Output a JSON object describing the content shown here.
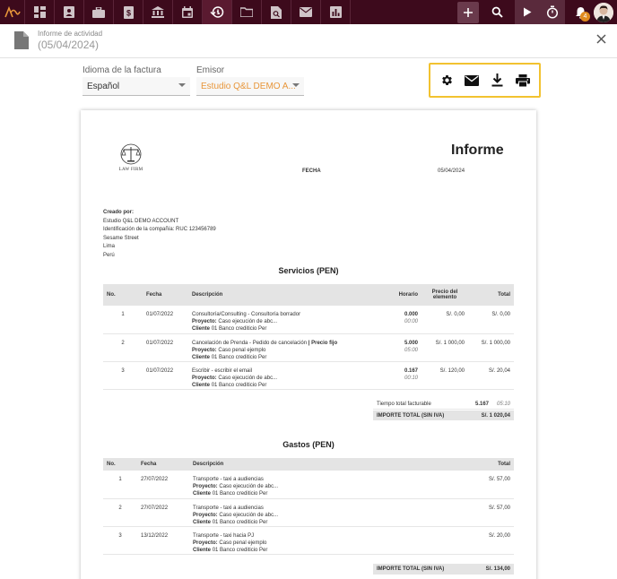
{
  "header": {
    "subtitle": "Informe de actividad",
    "title": "(05/04/2024)"
  },
  "filters": {
    "language_label": "Idioma de la factura",
    "language_value": "Español",
    "issuer_label": "Emisor",
    "issuer_value": "Estudio Q&L DEMO A..."
  },
  "notifications": {
    "count": "4"
  },
  "invoice": {
    "title": "Informe",
    "date_label": "FECHA",
    "date_value": "05/04/2024",
    "firm_name": "LAW FIRM",
    "created_by_label": "Creado por:",
    "created_lines": [
      "Estudio Q&L DEMO ACCOUNT",
      "Identificación de la compañía: RUC 123456789",
      "Sesame Street",
      "Lima",
      "Perú"
    ],
    "services": {
      "title": "Servicios (PEN)",
      "headers": {
        "no": "No.",
        "date": "Fecha",
        "desc": "Descripción",
        "hours": "Horario",
        "price": "Precio del elemento",
        "total": "Total"
      },
      "proyecto_label": "Proyecto:",
      "cliente_label": "Cliente",
      "rows": [
        {
          "no": "1",
          "date": "01/07/2022",
          "desc": "Consultoría/Consulting - Consultoría borrador",
          "desc_bold": "",
          "proyecto": "Caso ejecución de abc...",
          "cliente": "01  Banco crediticio Per",
          "hours": "0.000",
          "time": "00:00",
          "price": "S/. 0,00",
          "total": "S/. 0,00"
        },
        {
          "no": "2",
          "date": "01/07/2022",
          "desc": "Cancelación de Prenda - Pedido de cancelación",
          "desc_bold": "| Precio fijo",
          "proyecto": "Caso penal ejemplo",
          "cliente": "01  Banco crediticio Per",
          "hours": "5.000",
          "time": "05:00",
          "price": "S/. 1 000,00",
          "total": "S/. 1 000,00"
        },
        {
          "no": "3",
          "date": "01/07/2022",
          "desc": "Escribir - escribir el email",
          "desc_bold": "",
          "proyecto": "Caso ejecución de abc...",
          "cliente": "01  Banco crediticio Per",
          "hours": "0.167",
          "time": "00:10",
          "price": "S/. 120,00",
          "total": "S/. 20,04"
        }
      ],
      "billable_label": "Tiempo total facturable",
      "billable_hours": "5.167",
      "billable_time": "05:10",
      "total_label": "IMPORTE TOTAL (SIN IVA)",
      "total_value": "S/. 1 020,04"
    },
    "expenses": {
      "title": "Gastos (PEN)",
      "headers": {
        "no": "No.",
        "date": "Fecha",
        "desc": "Descripción",
        "total": "Total"
      },
      "proyecto_label": "Proyecto:",
      "cliente_label": "Cliente",
      "rows": [
        {
          "no": "1",
          "date": "27/07/2022",
          "desc": "Transporte - taxi a audiencias",
          "proyecto": "Caso ejecución de abc...",
          "cliente": "01    Banco crediticio Per",
          "total": "S/. 57,00"
        },
        {
          "no": "2",
          "date": "27/07/2022",
          "desc": "Transporte - taxi a audiencias",
          "proyecto": "Caso ejecución de abc...",
          "cliente": "01    Banco crediticio Per",
          "total": "S/. 57,00"
        },
        {
          "no": "3",
          "date": "13/12/2022",
          "desc": "Transporte - taxi hacia PJ",
          "proyecto": "Caso penal ejemplo",
          "cliente": "01    Banco crediticio Per",
          "total": "S/. 20,00"
        }
      ],
      "total_label": "IMPORTE TOTAL (SIN IVA)",
      "total_value": "S/. 134,00"
    }
  },
  "colors": {
    "navbar": "#3d0a1c",
    "accent_border": "#f2c230",
    "issuer_text": "#e8963a",
    "badge": "#e08a1e"
  }
}
